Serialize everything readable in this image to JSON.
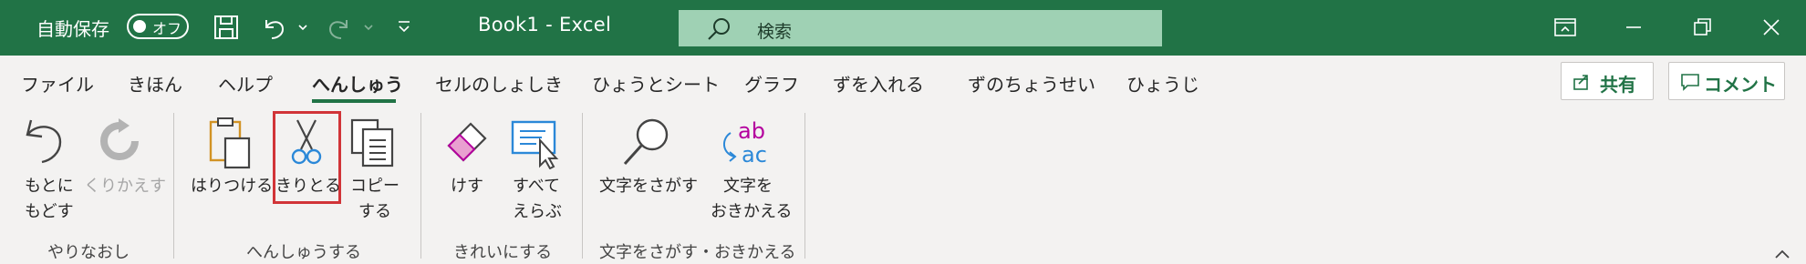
{
  "titlebar": {
    "autosave_label": "自動保存",
    "autosave_state": "オフ",
    "doc_title": "Book1  -  Excel",
    "search_placeholder": "検索",
    "bg_color": "#217346"
  },
  "tabs": [
    {
      "label": "ファイル"
    },
    {
      "label": "きほん"
    },
    {
      "label": "ヘルプ"
    },
    {
      "label": "へんしゅう",
      "active": true
    },
    {
      "label": "セルのしょしき"
    },
    {
      "label": "ひょうとシート"
    },
    {
      "label": "グラフ"
    },
    {
      "label": "ずを入れる"
    },
    {
      "label": "ずのちょうせい"
    },
    {
      "label": "ひょうじ"
    }
  ],
  "actions": {
    "share": "共有",
    "comment": "コメント"
  },
  "ribbon": {
    "undo": {
      "line1": "もとに",
      "line2": "もどす"
    },
    "redo": {
      "label": "くりかえす"
    },
    "group_undo": "やりなおし",
    "paste": {
      "label": "はりつける"
    },
    "cut": {
      "label": "きりとる"
    },
    "copy": {
      "line1": "コピー",
      "line2": "する"
    },
    "group_edit": "へんしゅうする",
    "erase": {
      "label": "けす"
    },
    "selectall": {
      "line1": "すべて",
      "line2": "えらぶ"
    },
    "group_clean": "きれいにする",
    "find": {
      "label": "文字をさがす"
    },
    "replace": {
      "line1": "文字を",
      "line2": "おきかえる"
    },
    "group_find": "文字をさがす・おきかえる"
  }
}
